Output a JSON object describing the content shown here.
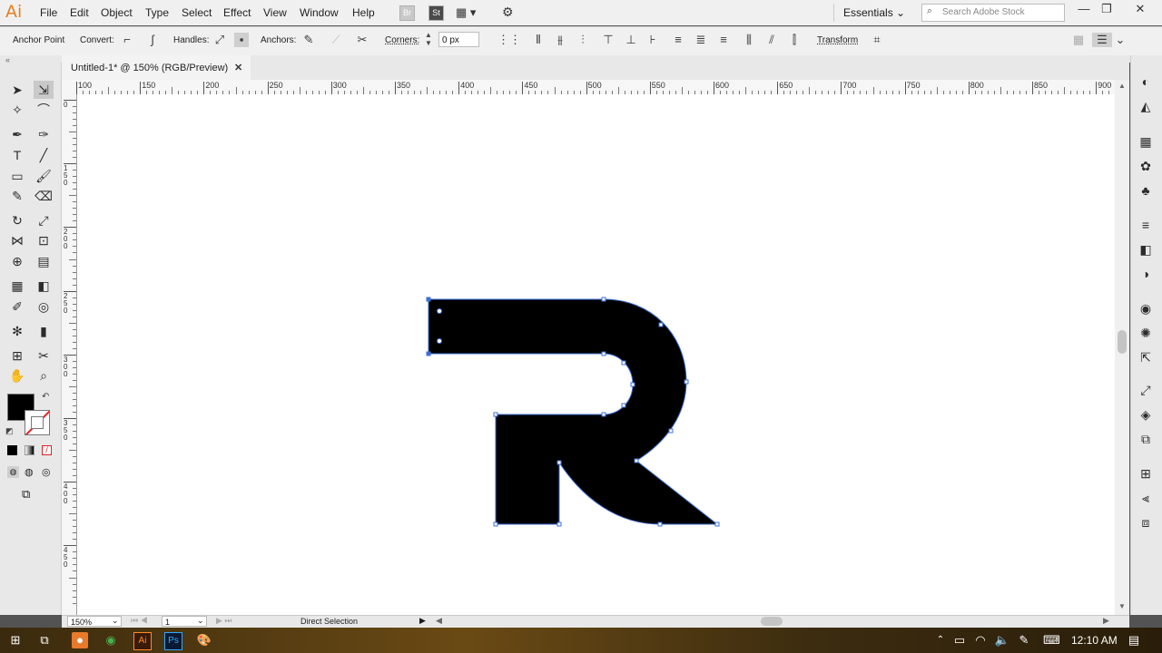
{
  "app": {
    "logo": "Ai"
  },
  "menu": [
    "File",
    "Edit",
    "Object",
    "Type",
    "Select",
    "Effect",
    "View",
    "Window",
    "Help"
  ],
  "menubar_right": {
    "workspace": "Essentials",
    "search_placeholder": "Search Adobe Stock",
    "bridge_icon": "St"
  },
  "control_bar": {
    "tool_label": "Anchor Point",
    "convert_label": "Convert:",
    "handles_label": "Handles:",
    "anchors_label": "Anchors:",
    "corners_label": "Corners:",
    "corners_value": "0 px",
    "transform_label": "Transform"
  },
  "document": {
    "tab_title": "Untitled-1* @ 150% (RGB/Preview)",
    "close_icon": "✕"
  },
  "ruler": {
    "h_ticks": [
      "100",
      "150",
      "200",
      "250",
      "300",
      "350",
      "400",
      "450",
      "500",
      "550",
      "600",
      "650",
      "700",
      "750",
      "800",
      "850",
      "900"
    ],
    "v_ticks": [
      "0",
      "1\n5\n0",
      "2\n0\n0",
      "2\n5\n0",
      "3\n0\n0",
      "3\n5\n0",
      "4\n0\n0",
      "4\n5\n0"
    ]
  },
  "status": {
    "zoom": "150%",
    "artboard": "1",
    "tool": "Direct Selection"
  },
  "taskbar": {
    "time": "12:10 AM"
  },
  "colors": {
    "fill": "#000000",
    "accent_orange": "#e77f1e",
    "selection_blue": "#3e6fd6"
  },
  "artwork": {
    "shape_name": "R-letter-shape"
  }
}
